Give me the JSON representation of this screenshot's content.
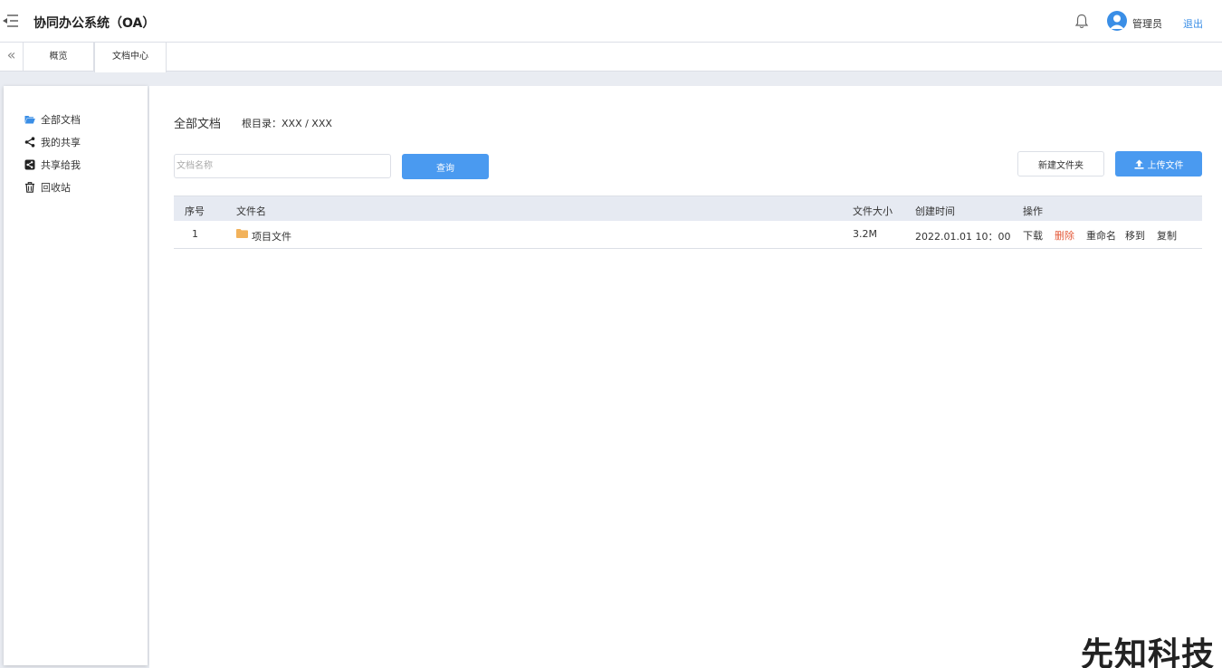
{
  "header": {
    "title": "协同办公系统（OA）",
    "user_name": "管理员",
    "logout_label": "退出"
  },
  "tabs": [
    {
      "label": "概览"
    },
    {
      "label": "文档中心"
    }
  ],
  "sidebar": {
    "items": [
      {
        "label": "全部文档",
        "icon": "folder-open-icon"
      },
      {
        "label": "我的共享",
        "icon": "share-icon"
      },
      {
        "label": "共享给我",
        "icon": "share-square-icon"
      },
      {
        "label": "回收站",
        "icon": "trash-icon"
      }
    ]
  },
  "main": {
    "heading": "全部文档",
    "root_path": "根目录：XXX / XXX",
    "search": {
      "placeholder": "文档名称"
    },
    "query_label": "查询",
    "new_folder_label": "新建文件夹",
    "upload_label": "上传文件",
    "table": {
      "headers": [
        "序号",
        "文件名",
        "文件大小",
        "创建时间",
        "操作"
      ],
      "rows": [
        {
          "index": "1",
          "name": "项目文件",
          "size": "3.2M",
          "created": "2022.01.01  10：00",
          "ops": [
            "下载",
            "删除",
            "重命名",
            "移到",
            "复制"
          ]
        }
      ]
    }
  },
  "watermark": "先知科技",
  "colors": {
    "accent": "#4a9af0",
    "danger": "#e45a3a",
    "link": "#3a8ee6"
  }
}
